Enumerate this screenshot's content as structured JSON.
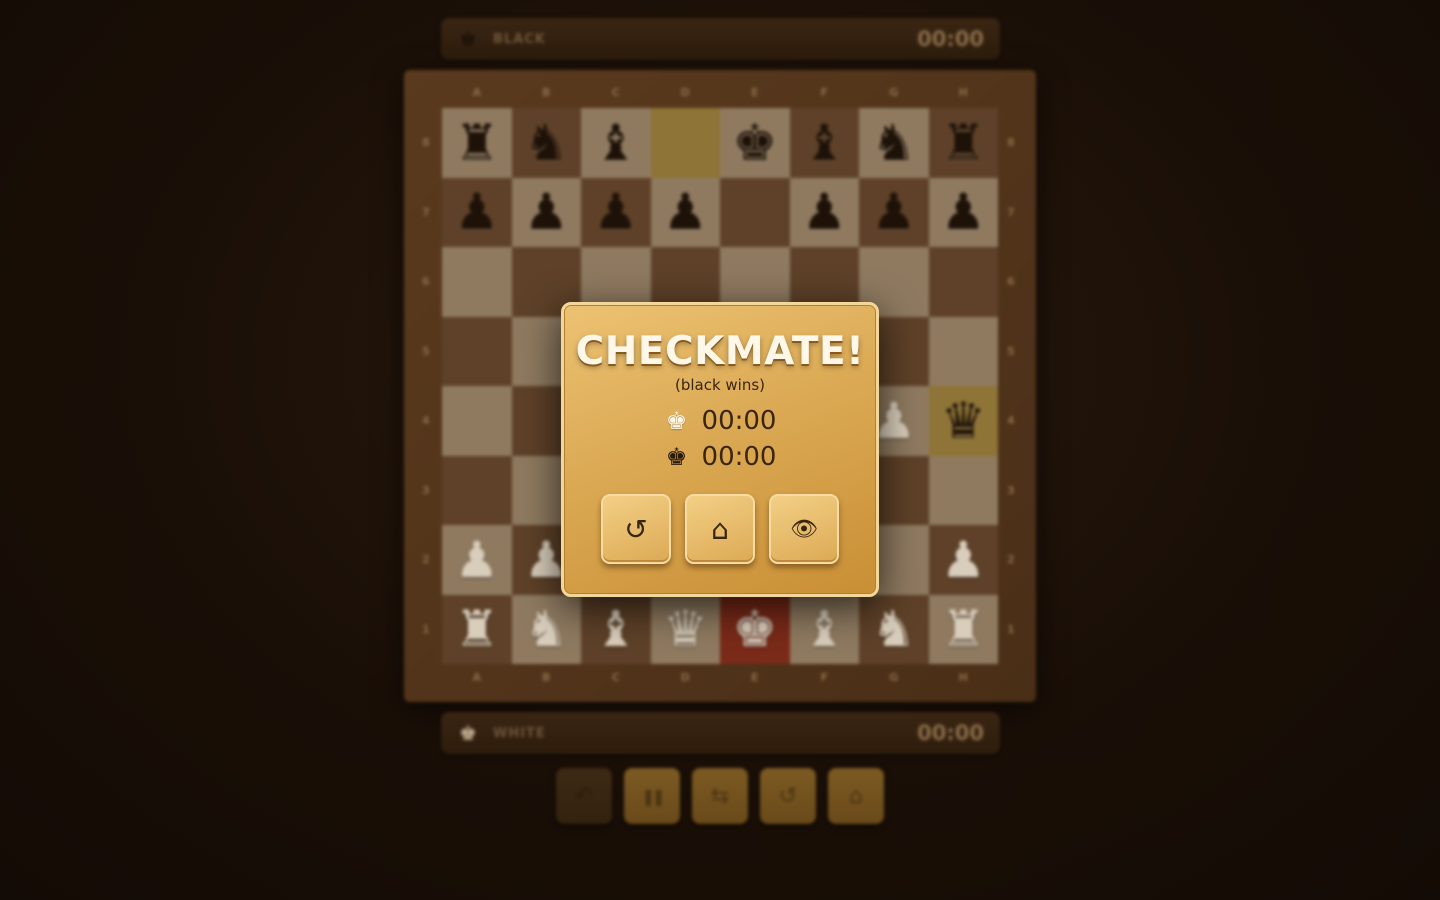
{
  "players": {
    "black": {
      "name": "BLACK",
      "time": "00:00",
      "icon": "black-king-icon"
    },
    "white": {
      "name": "WHITE",
      "time": "00:00",
      "icon": "white-king-icon"
    }
  },
  "board": {
    "files": [
      "A",
      "B",
      "C",
      "D",
      "E",
      "F",
      "G",
      "H"
    ],
    "ranks": [
      "8",
      "7",
      "6",
      "5",
      "4",
      "3",
      "2",
      "1"
    ],
    "rows": [
      [
        "br",
        "bn",
        "bb",
        "",
        "bk",
        "bb",
        "bn",
        "br"
      ],
      [
        "bp",
        "bp",
        "bp",
        "bp",
        "",
        "bp",
        "bp",
        "bp"
      ],
      [
        "",
        "",
        "",
        "",
        "",
        "",
        "",
        ""
      ],
      [
        "",
        "",
        "",
        "",
        "",
        "",
        "",
        ""
      ],
      [
        "",
        "",
        "",
        "",
        "",
        "",
        "wp",
        "bq"
      ],
      [
        "",
        "",
        "",
        "",
        "",
        "",
        "",
        ""
      ],
      [
        "wp",
        "wp",
        "",
        "",
        "",
        "",
        "",
        "wp"
      ],
      [
        "wr",
        "wn",
        "wb",
        "wq",
        "wk",
        "wb",
        "wn",
        "wr"
      ]
    ],
    "highlights": [
      "d8",
      "h4"
    ],
    "check_square": "e1",
    "colors": {
      "light": "#8f7a60",
      "dark": "#5e4128",
      "highlight": "#8e7436",
      "check": "#7a2a18"
    }
  },
  "controls": [
    {
      "name": "undo",
      "icon": "undo-icon",
      "glyph": "↶",
      "enabled": false
    },
    {
      "name": "pause",
      "icon": "pause-icon",
      "glyph": "❚❚",
      "enabled": true
    },
    {
      "name": "flip",
      "icon": "flip-board-icon",
      "glyph": "⇆",
      "enabled": true
    },
    {
      "name": "restart",
      "icon": "restart-icon",
      "glyph": "↺",
      "enabled": true
    },
    {
      "name": "home",
      "icon": "home-icon",
      "glyph": "⌂",
      "enabled": true
    }
  ],
  "modal": {
    "title": "CHECKMATE!",
    "subtitle": "(black wins)",
    "white_time": "00:00",
    "black_time": "00:00",
    "buttons": [
      {
        "name": "restart",
        "icon": "restart-icon",
        "glyph": "↺"
      },
      {
        "name": "home",
        "icon": "home-icon",
        "glyph": "⌂"
      },
      {
        "name": "view-board",
        "icon": "eye-icon",
        "glyph": "👁"
      }
    ],
    "accent_color": "#dba954"
  }
}
